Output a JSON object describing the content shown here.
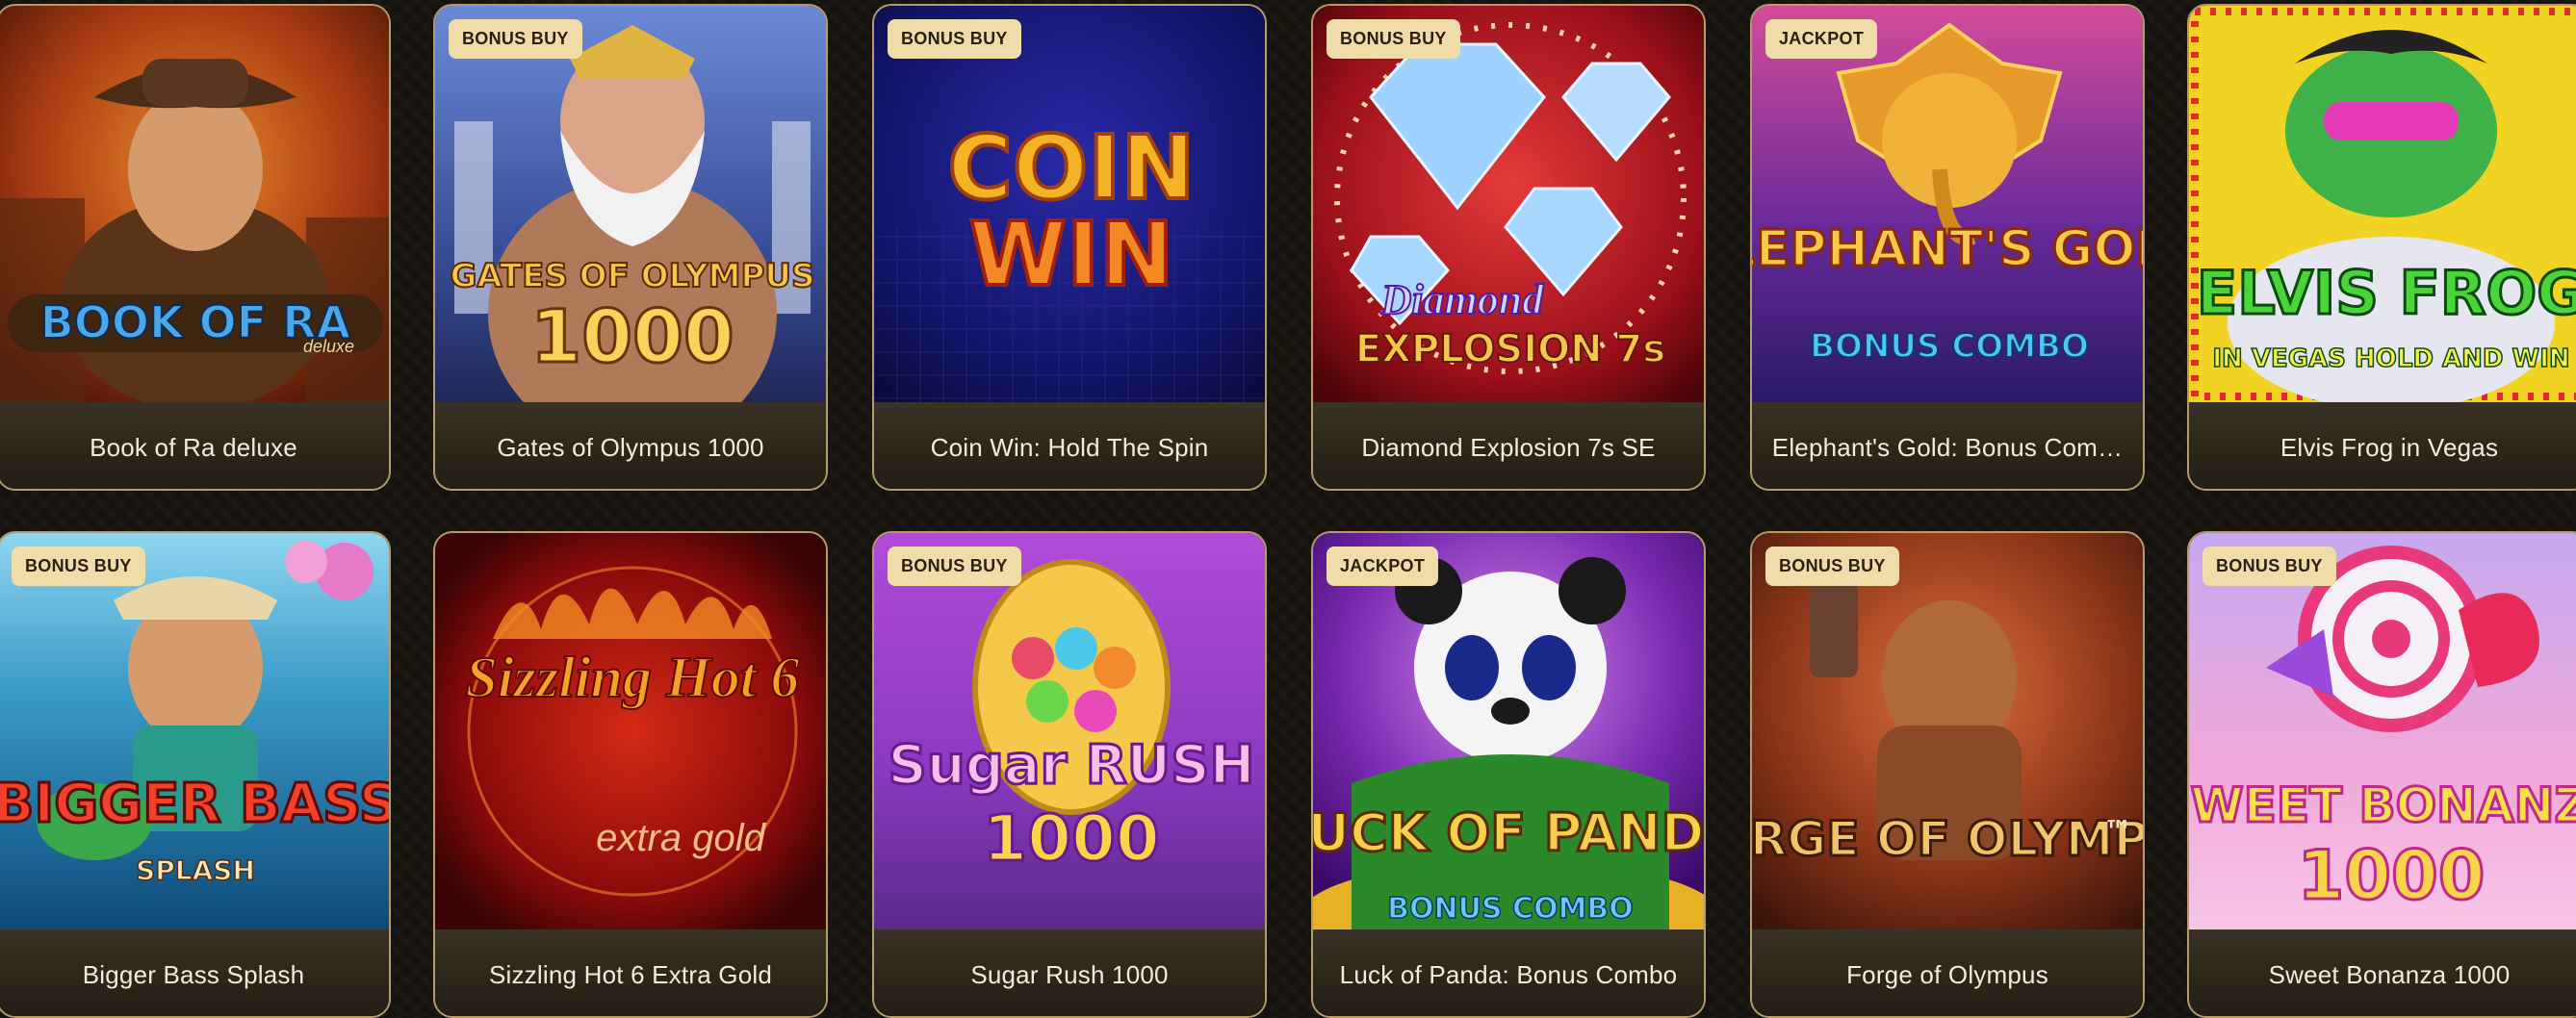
{
  "games": [
    {
      "title": "Book of Ra deluxe",
      "art_text": "BOOK OF RA",
      "art_sub": "deluxe"
    },
    {
      "badge": "BONUS BUY",
      "title": "Gates of Olympus 1000",
      "art_text": "GATES OF OLYMPUS",
      "art_sub": "1000"
    },
    {
      "badge": "BONUS BUY",
      "title": "Coin Win: Hold The Spin",
      "art_text": "COIN",
      "art_sub": "WIN"
    },
    {
      "badge": "BONUS BUY",
      "title": "Diamond Explosion 7s SE",
      "art_text": "Diamond",
      "art_sub": "EXPLOSION 7s"
    },
    {
      "badge": "JACKPOT",
      "title": "Elephant's Gold: Bonus Com…",
      "art_text": "ELEPHANT'S GOLD",
      "art_sub": "BONUS COMBO"
    },
    {
      "title": "Elvis Frog in Vegas",
      "art_text": "ELVIS FROG",
      "art_sub": "IN VEGAS HOLD AND WIN"
    },
    {
      "badge": "BONUS BUY",
      "title": "Bigger Bass Splash",
      "art_text": "BIGGER BASS",
      "art_sub": "SPLASH"
    },
    {
      "title": "Sizzling Hot 6 Extra Gold",
      "art_text": "Sizzling Hot 6",
      "art_sub": "extra gold"
    },
    {
      "badge": "BONUS BUY",
      "title": "Sugar Rush 1000",
      "art_text": "Sugar RUSH",
      "art_sub": "1000"
    },
    {
      "badge": "JACKPOT",
      "title": "Luck of Panda: Bonus Combo",
      "art_text": "LUCK OF PANDA",
      "art_sub": "BONUS COMBO"
    },
    {
      "badge": "BONUS BUY",
      "title": "Forge of Olympus",
      "art_text": "FORGE OF OLYMPUS",
      "art_sub": "™"
    },
    {
      "badge": "BONUS BUY",
      "title": "Sweet Bonanza 1000",
      "art_text": "SWEET BONANZA",
      "art_sub": "1000"
    }
  ],
  "colors": {
    "background": "#17140f",
    "card_border": "#b59a6a",
    "badge_bg": "#f0dca8",
    "caption_text": "#f3ecdd"
  }
}
